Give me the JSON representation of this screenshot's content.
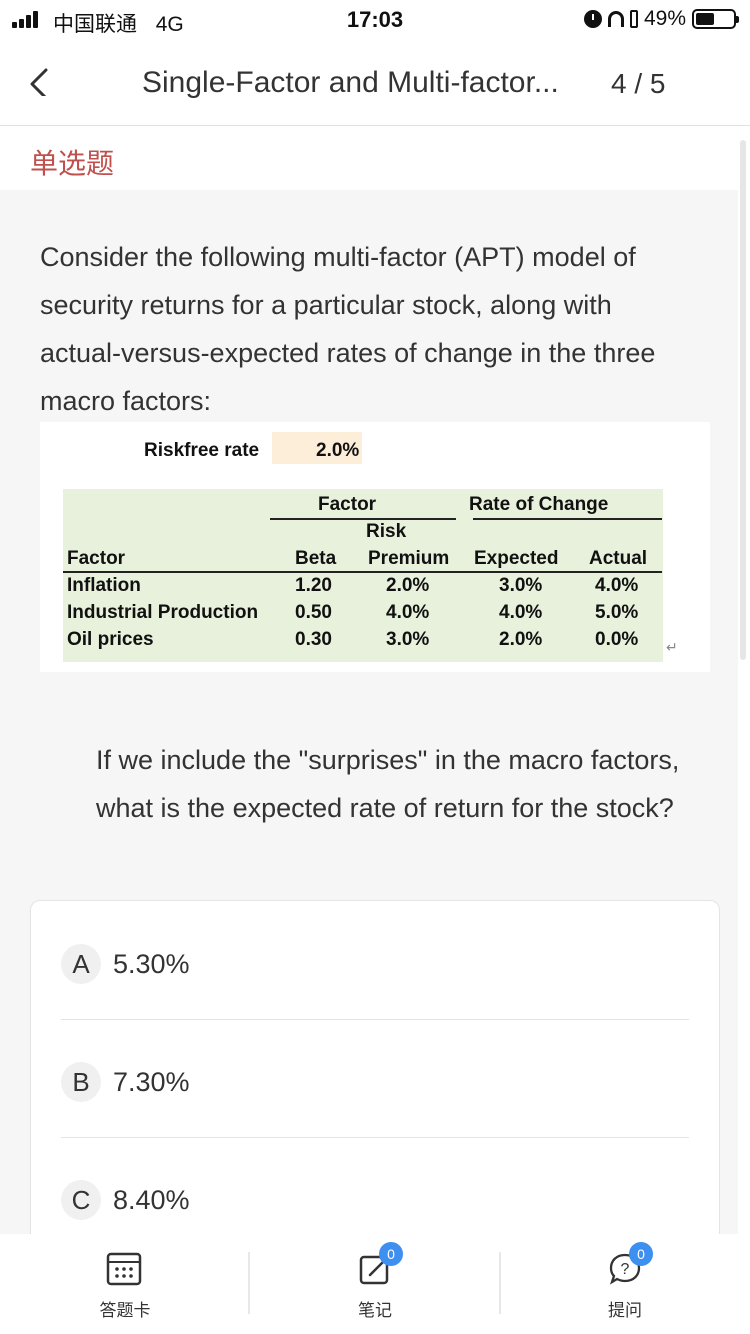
{
  "status_bar": {
    "carrier": "中国联通",
    "network": "4G",
    "time": "17:03",
    "battery": "49%",
    "battery_level": 0.49
  },
  "nav": {
    "title": "Single-Factor and Multi-factor...",
    "counter": "4 / 5"
  },
  "question": {
    "type_label": "单选题",
    "stem": "Consider the following multi-factor (APT) model of security returns for a particular stock, along with actual-versus-expected rates of change in the three macro factors:",
    "sub_question": "If we include the \"surprises\" in the macro factors, what is the expected rate of return for the stock?",
    "table": {
      "riskfree_label": "Riskfree rate",
      "riskfree_value": "2.0%",
      "group_factor": "Factor",
      "group_rate": "Rate of Change",
      "risk_label": "Risk",
      "headers": [
        "Factor",
        "Beta",
        "Premium",
        "Expected",
        "Actual"
      ],
      "rows": [
        [
          "Inflation",
          "1.20",
          "2.0%",
          "3.0%",
          "4.0%"
        ],
        [
          "Industrial Production",
          "0.50",
          "4.0%",
          "4.0%",
          "5.0%"
        ],
        [
          "Oil prices",
          "0.30",
          "3.0%",
          "2.0%",
          "0.0%"
        ]
      ]
    },
    "options": [
      {
        "letter": "A",
        "text": "5.30%"
      },
      {
        "letter": "B",
        "text": "7.30%"
      },
      {
        "letter": "C",
        "text": "8.40%"
      }
    ]
  },
  "bottom_bar": {
    "answer_card_label": "答题卡",
    "notes_label": "笔记",
    "notes_badge": "0",
    "ask_label": "提问",
    "ask_badge": "0"
  },
  "colors": {
    "accent_red": "#c0504d",
    "badge_blue": "#3d8ff0",
    "table_green": "#e8f1dc",
    "riskfree_highlight": "#fdeeda"
  }
}
